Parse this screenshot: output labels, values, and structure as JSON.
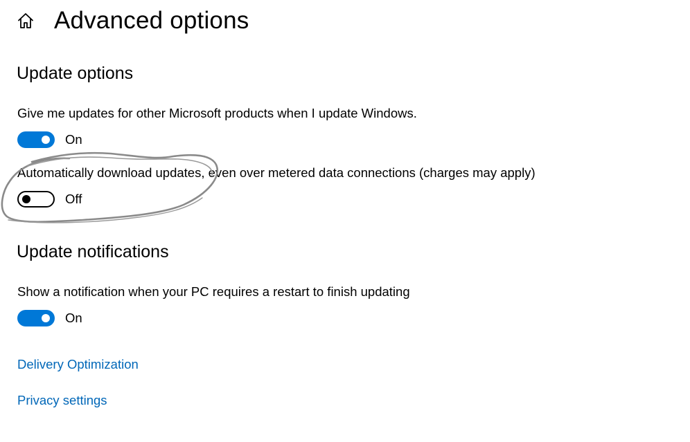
{
  "header": {
    "title": "Advanced options",
    "home_icon": "home-icon"
  },
  "update_options": {
    "heading": "Update options",
    "microsoft_products": {
      "label": "Give me updates for other Microsoft products when I update Windows.",
      "state": "On",
      "enabled": true
    },
    "metered_download": {
      "label": "Automatically download updates, even over metered data connections (charges may apply)",
      "state": "Off",
      "enabled": false
    }
  },
  "update_notifications": {
    "heading": "Update notifications",
    "restart_notification": {
      "label": "Show a notification when your PC requires a restart to finish updating",
      "state": "On",
      "enabled": true
    }
  },
  "links": {
    "delivery_optimization": "Delivery Optimization",
    "privacy_settings": "Privacy settings"
  },
  "colors": {
    "accent": "#0078d7",
    "link": "#0067b8",
    "annotation": "#8a8a8a"
  }
}
